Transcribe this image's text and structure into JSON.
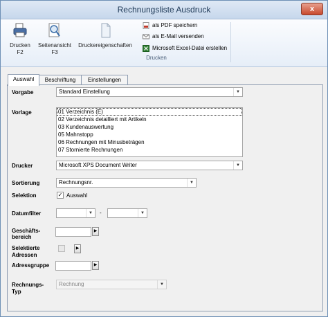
{
  "window": {
    "title": "Rechnungsliste Ausdruck",
    "close_glyph": "x"
  },
  "ribbon": {
    "print_label_1": "Drucken",
    "print_label_2": "F2",
    "preview_label_1": "Seitenansicht",
    "preview_label_2": "F3",
    "printer_props_label": "Druckereigenschaften",
    "pdf_label": "als PDF speichern",
    "email_label": "als E-Mail versenden",
    "excel_label": "Microsoft Excel-Datei erstellen",
    "group_label": "Drucken"
  },
  "tabs": [
    "Auswahl",
    "Beschriftung",
    "Einstellungen"
  ],
  "form": {
    "vorgabe_label": "Vorgabe",
    "vorgabe_value": "Standard Einstellung",
    "vorlage_label": "Vorlage",
    "vorlage_items": [
      "01 Verzeichnis (E)",
      "02 Verzeichnis detailliert mit Artikeln",
      "03 Kundenauswertung",
      "05 Mahnstopp",
      "06 Rechnungen mit Minusbeträgen",
      "07 Stornierte Rechnungen"
    ],
    "drucker_label": "Drucker",
    "drucker_value": "Microsoft XPS Document Writer",
    "sortierung_label": "Sortierung",
    "sortierung_value": "Rechnungsnr.",
    "selektion_label": "Selektion",
    "auswahl_label": "Auswahl",
    "datumfilter_label": "Datumfilter",
    "date_separator": "-",
    "geschaeftsbereich_label_1": "Geschäfts-",
    "geschaeftsbereich_label_2": "bereich",
    "selektierte_label_1": "Selektierte",
    "selektierte_label_2": "Adressen",
    "adressgruppe_label": "Adressgruppe",
    "rechnungstyp_label_1": "Rechnungs-",
    "rechnungstyp_label_2": "Typ",
    "rechnungstyp_value": "Rechnung"
  }
}
